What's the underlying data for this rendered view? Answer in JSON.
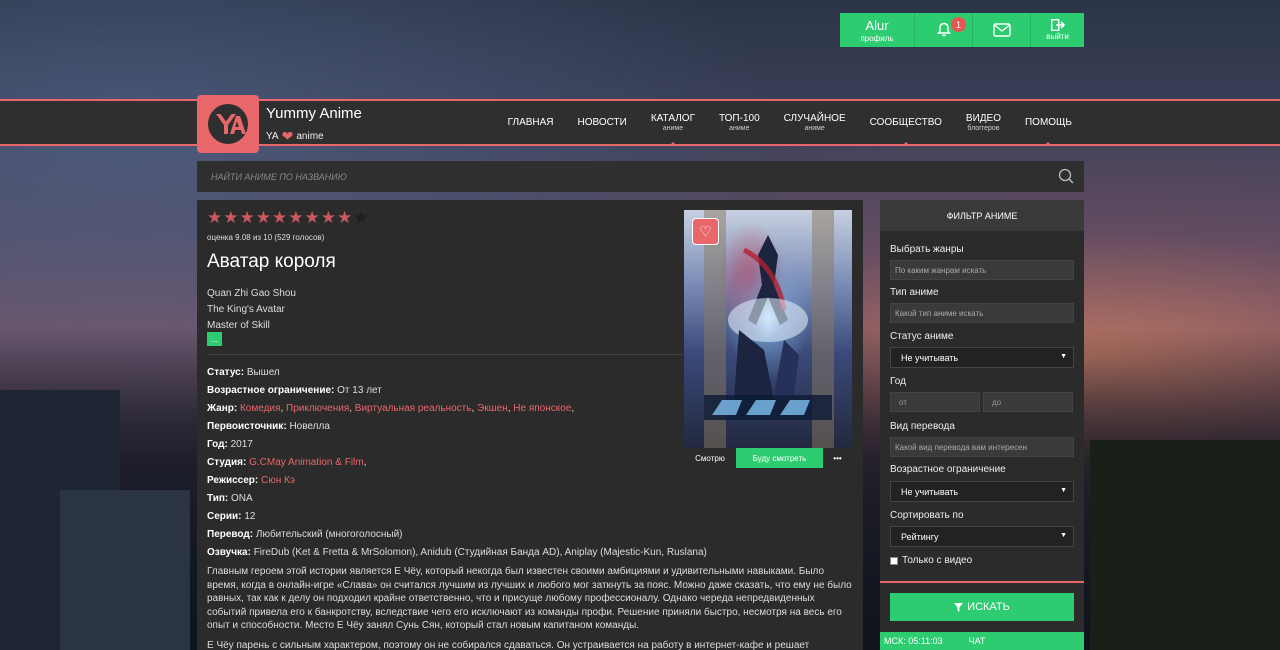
{
  "userbar": {
    "username": "Alur",
    "profile_label": "профиль",
    "notifications": "1",
    "exit_label": "выйти"
  },
  "header": {
    "site_title": "Yummy Anime",
    "tag_left": "YA",
    "tag_right": "anime",
    "nav": [
      {
        "label": "ГЛАВНАЯ",
        "sub": ""
      },
      {
        "label": "НОВОСТИ",
        "sub": ""
      },
      {
        "label": "КАТАЛОГ",
        "sub": "аниме"
      },
      {
        "label": "ТОП-100",
        "sub": "аниме"
      },
      {
        "label": "СЛУЧАЙНОЕ",
        "sub": "аниме"
      },
      {
        "label": "СООБЩЕСТВО",
        "sub": ""
      },
      {
        "label": "ВИДЕО",
        "sub": "блоггеров"
      },
      {
        "label": "ПОМОЩЬ",
        "sub": ""
      }
    ]
  },
  "search": {
    "placeholder": "НАЙТИ АНИМЕ ПО НАЗВАНИЮ"
  },
  "anime": {
    "stars_filled": 9,
    "stars_total": 10,
    "rating_text": "оценка 9.08 из 10 (529 голосов)",
    "title": "Аватар короля",
    "alt_names": [
      "Quan Zhi Gao Shou",
      "The King's Avatar",
      "Master of Skill"
    ],
    "more": "...",
    "status_label": "Статус:",
    "status": "Вышел",
    "age_label": "Возрастное ограничение:",
    "age": "От 13 лет",
    "genre_label": "Жанр:",
    "genres": [
      "Комедия",
      "Приключения",
      "Виртуальная реальность",
      "Экшен",
      "Не японское"
    ],
    "source_label": "Первоисточник:",
    "source": "Новелла",
    "year_label": "Год:",
    "year": "2017",
    "studio_label": "Студия:",
    "studio": "G.CMay Animation & Film",
    "director_label": "Режиссер:",
    "director": "Сюн Кэ",
    "type_label": "Тип:",
    "type": "ONA",
    "episodes_label": "Серии:",
    "episodes": "12",
    "translation_label": "Перевод:",
    "translation": "Любительский (многоголосный)",
    "voice_label": "Озвучка:",
    "voice": "FireDub (Ket & Fretta & MrSolomon), Anidub (Студийная Банда AD), Aniplay (Majestic-Kun, Ruslana)",
    "description_1": "Главным героем этой истории является Е Чёу, который некогда был известен своими амбициями и удивительными навыками. Было время, когда в онлайн-игре «Слава» он считался лучшим из лучших и любого мог заткнуть за пояс. Можно даже сказать, что ему не было равных, так как к делу он подходил крайне ответственно, что и присуще любому профессионалу. Однако череда непредвиденных событий привела его к банкротству, вследствие чего его исключают из команды профи. Решение приняли быстро, несмотря на весь его опыт и способности. Место Е Чёу занял Сунь Сян, который стал новым капитаном команды.",
    "description_2": "Е Чёу парень с сильным характером, поэтому он не собирался сдаваться. Он устраивается на работу в интернет-кафе и решает",
    "watch_now": "Смотрю",
    "will_watch": "Буду смотреть",
    "watch_more": "•••"
  },
  "filter": {
    "heading": "ФИЛЬТР АНИМЕ",
    "genres_label": "Выбрать жанры",
    "genres_placeholder": "По каким жанрам искать",
    "type_label": "Тип аниме",
    "type_placeholder": "Какой тип аниме искать",
    "status_label": "Статус аниме",
    "status_value": "Не учитывать",
    "year_label": "Год",
    "year_from": "от",
    "year_to": "до",
    "translation_label": "Вид перевода",
    "translation_placeholder": "Какой вид перевода вам интересен",
    "age_label": "Возрастное ограничение",
    "age_value": "Не учитывать",
    "sort_label": "Сортировать по",
    "sort_value": "Рейтингу",
    "video_only": "Только с видео",
    "search_button": "ИСКАТЬ",
    "clock": "МСК: 05:11:03",
    "chat": "ЧАТ"
  },
  "colors": {
    "accent": "#e8676a",
    "green": "#2ecc71",
    "panel": "#2b2b2b"
  }
}
